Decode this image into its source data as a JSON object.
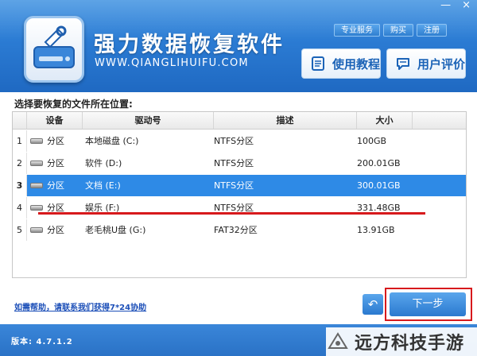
{
  "window": {
    "controls": [
      "—",
      "×"
    ]
  },
  "header": {
    "title": "强力数据恢复软件",
    "url": "WWW.QIANGLIHUIFU.COM",
    "top_links": [
      "专业服务",
      "购买",
      "注册"
    ],
    "buttons": {
      "tutorial": "使用教程",
      "review": "用户评价"
    }
  },
  "main": {
    "prompt": "选择要恢复的文件所在位置:",
    "columns": [
      "设备",
      "驱动号",
      "描述",
      "大小"
    ],
    "rows": [
      {
        "idx": "1",
        "device": "分区",
        "drive": "本地磁盘 (C:)",
        "desc": "NTFS分区",
        "size": "100GB"
      },
      {
        "idx": "2",
        "device": "分区",
        "drive": "软件 (D:)",
        "desc": "NTFS分区",
        "size": "200.01GB"
      },
      {
        "idx": "3",
        "device": "分区",
        "drive": "文档 (E:)",
        "desc": "NTFS分区",
        "size": "300.01GB",
        "selected": true
      },
      {
        "idx": "4",
        "device": "分区",
        "drive": "娱乐 (F:)",
        "desc": "NTFS分区",
        "size": "331.48GB"
      },
      {
        "idx": "5",
        "device": "分区",
        "drive": "老毛桃U盘 (G:)",
        "desc": "FAT32分区",
        "size": "13.91GB"
      }
    ],
    "help_text": "如需帮助，请联系我们获得7*24协助",
    "back_symbol": "↶",
    "next_label": "下一步"
  },
  "footer": {
    "version": "版本: 4.7.1.2"
  },
  "watermark": {
    "text": "远方科技手游"
  },
  "colors": {
    "brand": "#2b7bd3",
    "selected_row": "#2e8ae6",
    "highlight": "#d7191c"
  }
}
